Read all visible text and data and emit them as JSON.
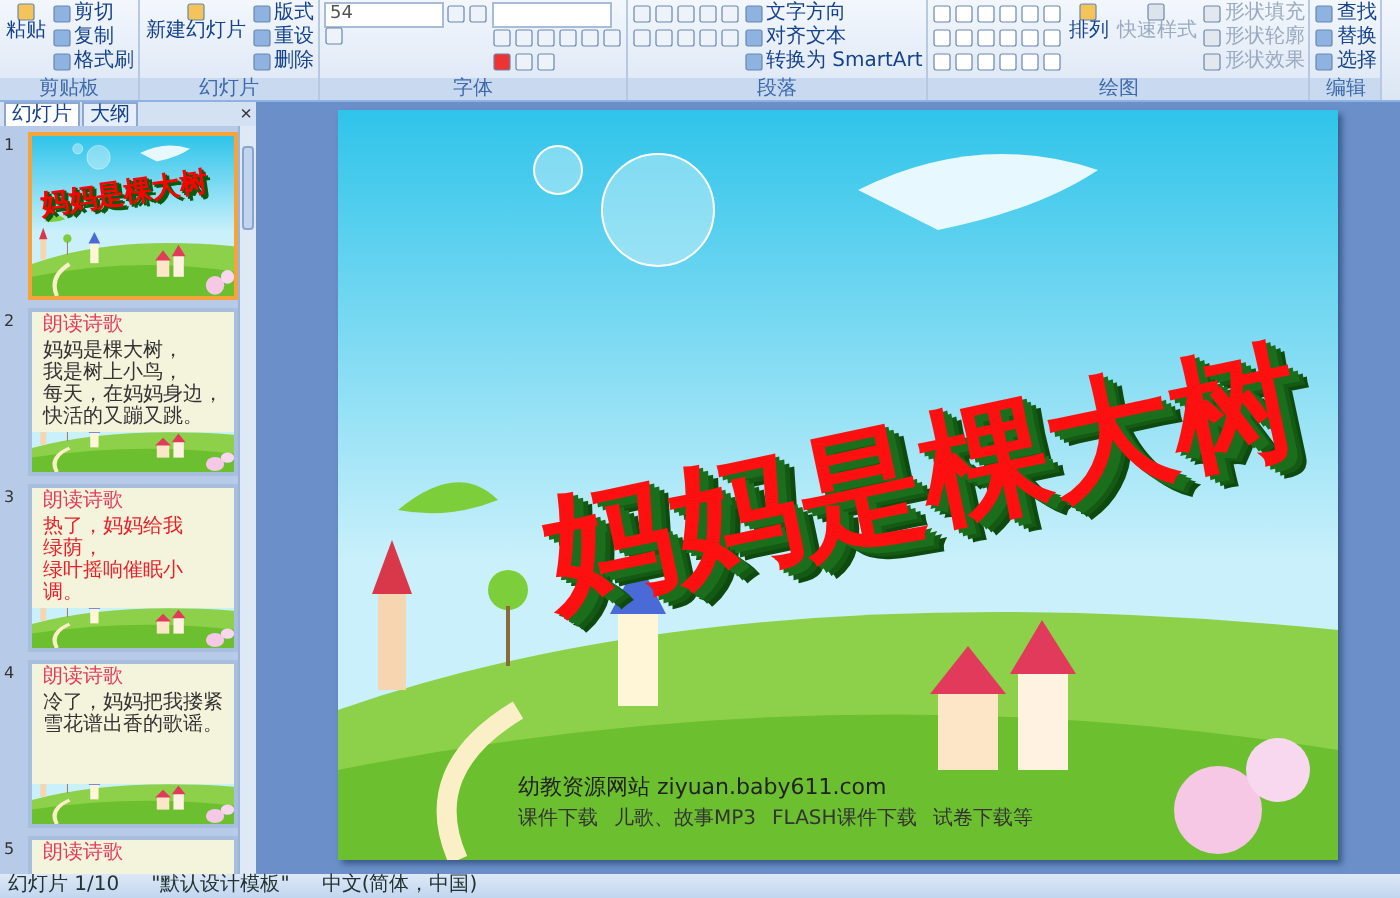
{
  "ribbon": {
    "groups": [
      {
        "label": "剪贴板",
        "kind": "clipboard",
        "items": [
          {
            "label": "粘贴",
            "kind": "large",
            "disabled": false
          },
          {
            "label": "剪切",
            "kind": "small",
            "disabled": false
          },
          {
            "label": "复制",
            "kind": "small",
            "disabled": false
          },
          {
            "label": "格式刷",
            "kind": "small",
            "disabled": false
          }
        ]
      },
      {
        "label": "幻灯片",
        "kind": "slides",
        "items": [
          {
            "label": "新建幻灯片",
            "kind": "large",
            "disabled": false
          },
          {
            "label": "版式",
            "kind": "small",
            "disabled": false
          },
          {
            "label": "重设",
            "kind": "small",
            "disabled": false
          },
          {
            "label": "删除",
            "kind": "small",
            "disabled": false
          }
        ]
      },
      {
        "label": "字体",
        "kind": "font",
        "items": [
          {
            "label": "54",
            "kind": "field",
            "disabled": false
          }
        ]
      },
      {
        "label": "段落",
        "kind": "paragraph",
        "items": [
          {
            "label": "文字方向",
            "kind": "small",
            "disabled": false
          },
          {
            "label": "对齐文本",
            "kind": "small",
            "disabled": false
          },
          {
            "label": "转换为 SmartArt",
            "kind": "small",
            "disabled": false
          }
        ]
      },
      {
        "label": "绘图",
        "kind": "drawing",
        "items": [
          {
            "label": "排列",
            "kind": "large",
            "disabled": false
          },
          {
            "label": "快速样式",
            "kind": "large",
            "disabled": true
          },
          {
            "label": "形状填充",
            "kind": "small",
            "disabled": true
          },
          {
            "label": "形状轮廓",
            "kind": "small",
            "disabled": true
          },
          {
            "label": "形状效果",
            "kind": "small",
            "disabled": true
          }
        ]
      },
      {
        "label": "编辑",
        "kind": "editing",
        "items": [
          {
            "label": "查找",
            "kind": "small",
            "disabled": false
          },
          {
            "label": "替换",
            "kind": "small",
            "disabled": false
          },
          {
            "label": "选择",
            "kind": "small",
            "disabled": false
          }
        ]
      }
    ]
  },
  "pane": {
    "tabs": [
      {
        "label": "幻灯片",
        "selected": true
      },
      {
        "label": "大纲",
        "selected": false
      }
    ],
    "close": "×",
    "thumbnails": [
      {
        "number": "1",
        "kind": "title",
        "selected": true,
        "title": "妈妈是棵大树"
      },
      {
        "number": "2",
        "kind": "poem",
        "selected": false,
        "title": "朗读诗歌",
        "lines": [
          "妈妈是棵大树，",
          "我是树上小鸟，",
          "每天，在妈妈身边，",
          "快活的又蹦又跳。"
        ]
      },
      {
        "number": "3",
        "kind": "poem-red",
        "selected": false,
        "title": "朗读诗歌",
        "lines": [
          "热了，妈妈给我",
          "绿荫，",
          "绿叶摇响催眠小",
          "调。"
        ]
      },
      {
        "number": "4",
        "kind": "poem",
        "selected": false,
        "title": "朗读诗歌",
        "lines": [
          "冷了，妈妈把我搂紧",
          "雪花谱出香的歌谣。"
        ]
      },
      {
        "number": "5",
        "kind": "poem",
        "selected": false,
        "title": "朗读诗歌"
      }
    ]
  },
  "slide": {
    "title": "妈妈是棵大树",
    "footer": {
      "site": "幼教资源网站 ziyuan.baby611.com",
      "links": [
        "课件下载",
        "儿歌、故事MP3",
        "FLASH课件下载",
        "试卷下载等"
      ]
    }
  },
  "status_bar": {
    "slide": "幻灯片 1/10",
    "theme": "\"默认设计模板\"",
    "language": "中文(简体，中国)"
  }
}
